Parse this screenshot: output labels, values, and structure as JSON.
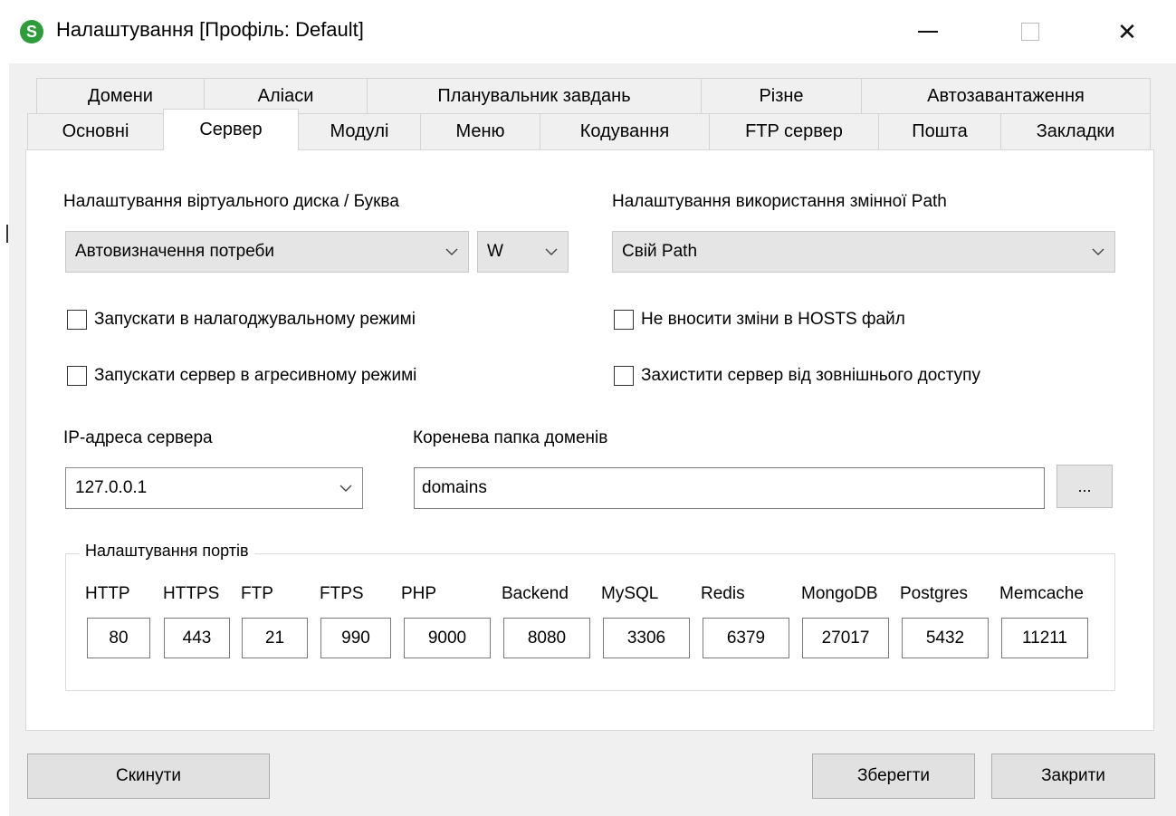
{
  "window": {
    "title": "Налаштування [Профіль: Default]",
    "icon_letter": "S",
    "minimize_icon": "minimize-icon",
    "maximize_icon": "maximize-icon",
    "close_symbol": "✕"
  },
  "tabs_row1": [
    "Домени",
    "Аліаси",
    "Планувальник завдань",
    "Різне",
    "Автозавантаження"
  ],
  "tabs_row2": [
    "Основні",
    "Сервер",
    "Модулі",
    "Меню",
    "Кодування",
    "FTP сервер",
    "Пошта",
    "Закладки"
  ],
  "active_tab": "Сервер",
  "server": {
    "vdisk_label": "Налаштування віртуального диска / Буква",
    "vdisk_mode": "Автовизначення потреби",
    "vdisk_letter": "W",
    "path_label": "Налаштування використання змінної Path",
    "path_mode": "Свій Path",
    "debug_mode_label": "Запускати в налагоджувальному режимі",
    "aggressive_mode_label": "Запускати сервер в агресивному режимі",
    "no_hosts_label": "Не вносити зміни в HOSTS файл",
    "protect_label": "Захистити сервер від зовнішнього доступу",
    "ip_label": "IP-адреса сервера",
    "ip_value": "127.0.0.1",
    "root_label": "Коренева папка доменів",
    "root_value": "domains",
    "browse_label": "..."
  },
  "ports": {
    "group_title": "Налаштування портів",
    "items": [
      {
        "name": "HTTP",
        "value": "80"
      },
      {
        "name": "HTTPS",
        "value": "443"
      },
      {
        "name": "FTP",
        "value": "21"
      },
      {
        "name": "FTPS",
        "value": "990"
      },
      {
        "name": "PHP",
        "value": "9000"
      },
      {
        "name": "Backend",
        "value": "8080"
      },
      {
        "name": "MySQL",
        "value": "3306"
      },
      {
        "name": "Redis",
        "value": "6379"
      },
      {
        "name": "MongoDB",
        "value": "27017"
      },
      {
        "name": "Postgres",
        "value": "5432"
      },
      {
        "name": "Memcache",
        "value": "11211"
      }
    ]
  },
  "buttons": {
    "reset": "Скинути",
    "save": "Зберегти",
    "close": "Закрити"
  },
  "colors": {
    "icon_green": "#2e9c3a",
    "window_bg": "#f0f0f0",
    "panel_bg": "#ffffff"
  }
}
